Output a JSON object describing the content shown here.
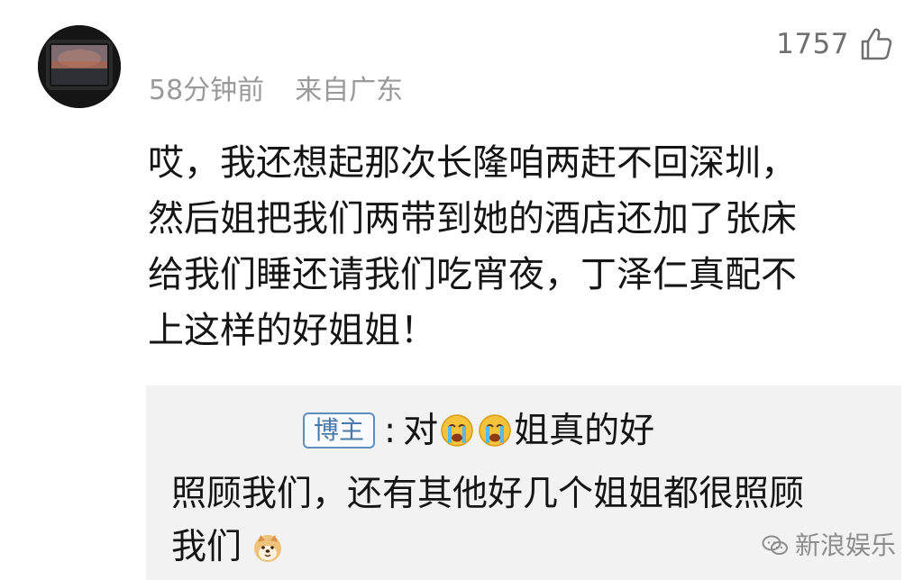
{
  "header": {
    "time_ago": "58分钟前",
    "location": "来自广东",
    "likes": "1757"
  },
  "comment": {
    "lines": [
      "哎，我还想起那次长隆咱两赶不回深圳，",
      "然后姐把我们两带到她的酒店还加了张床",
      "给我们睡还请我们吃宵夜，丁泽仁真配不",
      "上这样的好姐姐！"
    ]
  },
  "reply": {
    "badge": "博主",
    "colon": ":",
    "prefix": "对",
    "line1_tail": "姐真的好",
    "line2": "照顾我们，还有其他好几个姐姐都很照顾",
    "line3": "我们"
  },
  "watermark": {
    "text": "新浪娱乐"
  },
  "icons": {
    "avatar": "avatar",
    "like": "thumbs-up-icon",
    "cry": "crying-face-emoji",
    "dog": "dog-emoji",
    "wechat": "wechat-icon"
  },
  "colors": {
    "badge_border": "#5f8fbf",
    "badge_text": "#4a78a8",
    "reply_background": "#f2f2f2",
    "meta_text": "#9a9a9a"
  }
}
